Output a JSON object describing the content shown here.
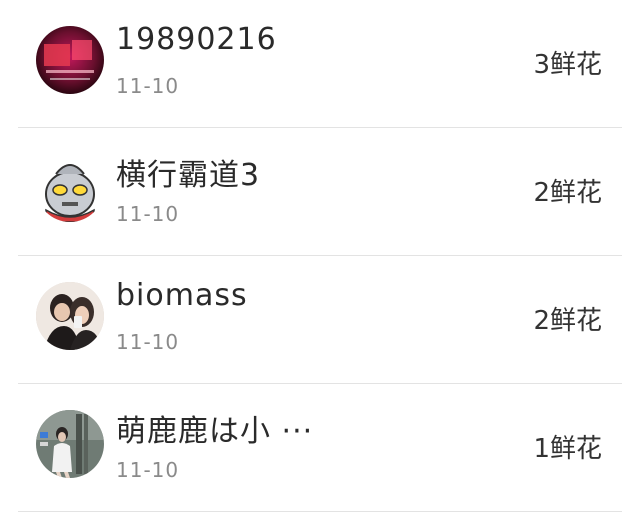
{
  "items": [
    {
      "name": "19890216",
      "date": "11-10",
      "flowers": "3鲜花",
      "avatar": "red-poster-avatar"
    },
    {
      "name": "横行霸道3",
      "date": "11-10",
      "flowers": "2鲜花",
      "avatar": "ultraman-avatar"
    },
    {
      "name": "biomass",
      "date": "11-10",
      "flowers": "2鲜花",
      "avatar": "couple-photo-avatar"
    },
    {
      "name": "萌鹿鹿は小 ···",
      "date": "11-10",
      "flowers": "1鲜花",
      "avatar": "street-photo-avatar"
    }
  ]
}
